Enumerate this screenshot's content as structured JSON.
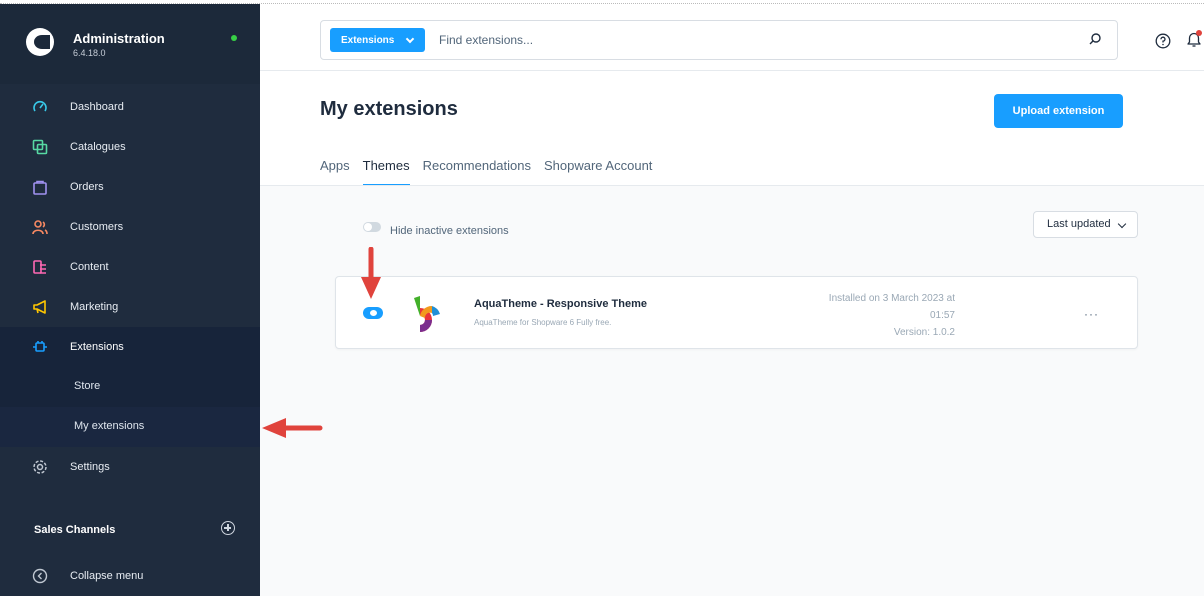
{
  "app": {
    "title": "Administration",
    "version": "6.4.18.0",
    "status_color": "#37d046"
  },
  "sidebar": {
    "items": [
      {
        "label": "Dashboard",
        "icon": "dashboard-icon"
      },
      {
        "label": "Catalogues",
        "icon": "catalogues-icon"
      },
      {
        "label": "Orders",
        "icon": "orders-icon"
      },
      {
        "label": "Customers",
        "icon": "customers-icon"
      },
      {
        "label": "Content",
        "icon": "content-icon"
      },
      {
        "label": "Marketing",
        "icon": "marketing-icon"
      },
      {
        "label": "Extensions",
        "icon": "extensions-icon",
        "active": true
      },
      {
        "label": "Settings",
        "icon": "settings-icon"
      }
    ],
    "subitems": [
      {
        "label": "Store"
      },
      {
        "label": "My extensions",
        "current": true
      }
    ],
    "sales_channels": "Sales Channels",
    "collapse": "Collapse menu"
  },
  "search": {
    "type_label": "Extensions",
    "placeholder": "Find extensions..."
  },
  "page": {
    "title": "My extensions",
    "upload_label": "Upload extension",
    "tabs": [
      {
        "label": "Apps"
      },
      {
        "label": "Themes",
        "active": true
      },
      {
        "label": "Recommendations"
      },
      {
        "label": "Shopware Account"
      }
    ],
    "hide_inactive_label": "Hide inactive extensions",
    "sort_label": "Last updated"
  },
  "extension": {
    "name": "AquaTheme - Responsive Theme",
    "description": "AquaTheme for Shopware 6 Fully free.",
    "installed_line1": "Installed on 3 March 2023 at",
    "installed_line2": "01:57",
    "version": "Version: 1.0.2",
    "active": true,
    "more": "···"
  },
  "colors": {
    "accent": "#189eff",
    "sidebar_bg": "#1f2c3e",
    "annotation_arrow": "#e0433c",
    "marketing_icon": "#ffc700",
    "extensions_icon": "#189eff"
  }
}
